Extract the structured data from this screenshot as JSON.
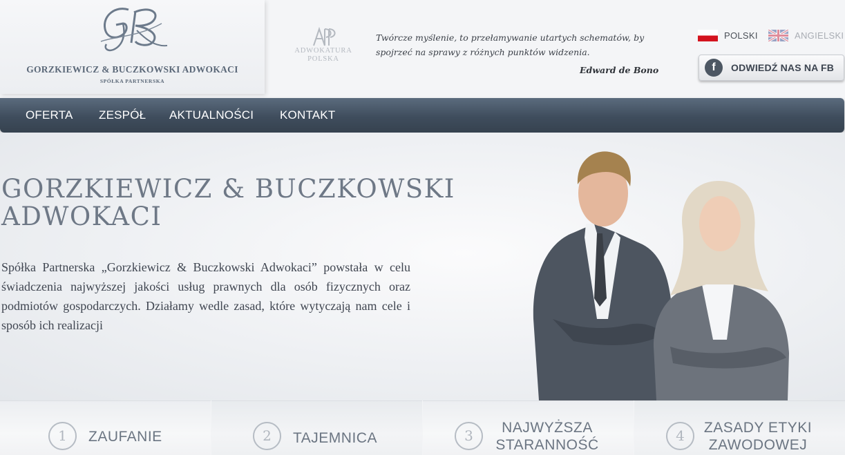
{
  "header": {
    "logo_name": "GORZKIEWICZ & BUCZKOWSKI ADWOKACI",
    "logo_subtitle": "SPÓŁKA PARTNERSKA",
    "bar_association": {
      "line1": "ADWOKATURA",
      "line2": "POLSKA"
    },
    "quote": "Twórcze myślenie, to przełamywanie utartych schematów, by spojrzeć na sprawy z różnych punktów widzenia.",
    "quote_author": "Edward de Bono",
    "languages": [
      {
        "label": "POLSKI",
        "flag": "pl-flag-icon",
        "active": true
      },
      {
        "label": "ANGIELSKI",
        "flag": "uk-flag-icon",
        "active": false
      }
    ],
    "facebook_button": {
      "icon": "facebook-icon",
      "label": "ODWIEDŹ NAS NA FB"
    }
  },
  "nav": {
    "items": [
      {
        "label": "OFERTA"
      },
      {
        "label": "ZESPÓŁ"
      },
      {
        "label": "AKTUALNOŚCI"
      },
      {
        "label": "KONTAKT"
      }
    ]
  },
  "hero": {
    "title_line1": "GORZKIEWICZ & BUCZKOWSKI",
    "title_line2": "ADWOKACI",
    "description": "Spółka Partnerska „Gorzkiewicz & Buczkowski Adwokaci” powstała w celu świadczenia najwyższej jakości usług prawnych dla osób fizycznych oraz podmiotów gospodarczych. Działamy wedle zasad, które wytyczają nam cele i sposób ich realizacji"
  },
  "values": [
    {
      "number": "1",
      "line1": "ZAUFANIE",
      "line2": ""
    },
    {
      "number": "2",
      "line1": "TAJEMNICA",
      "line2": ""
    },
    {
      "number": "3",
      "line1": "NAJWYŻSZA",
      "line2": "STARANNOŚĆ"
    },
    {
      "number": "4",
      "line1": "ZASADY ETYKI",
      "line2": "ZAWODOWEJ"
    }
  ],
  "colors": {
    "nav_background": "#3f4d5d",
    "logo_text": "#5b6878",
    "hero_title": "#6e7886",
    "accent_flag_red": "#d4131e"
  }
}
